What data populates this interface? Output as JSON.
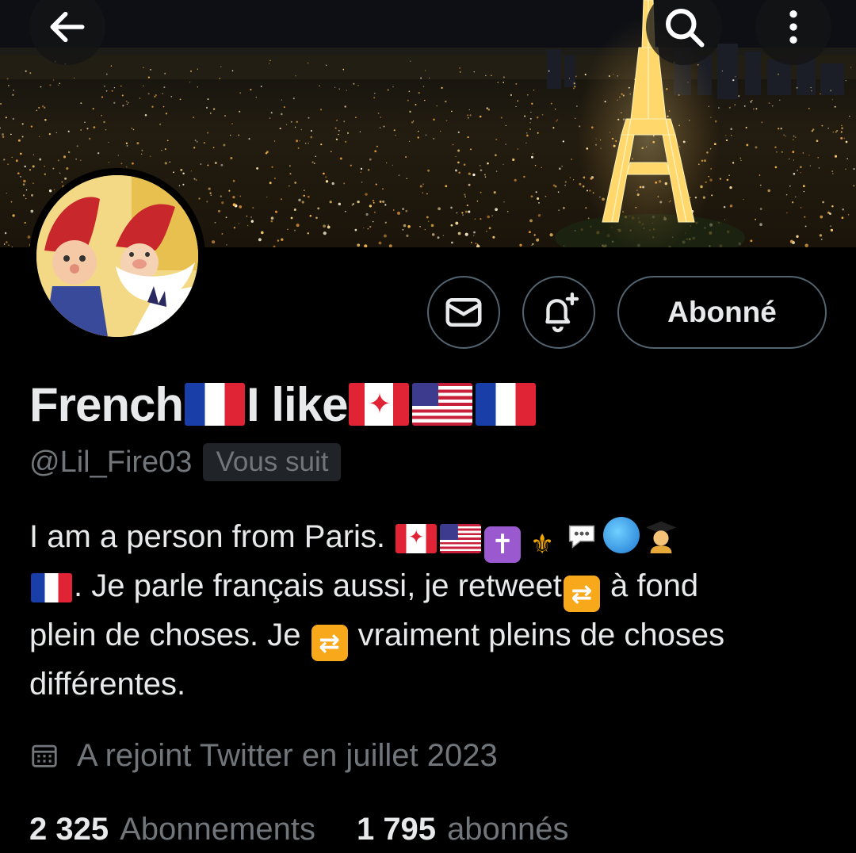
{
  "header": {
    "back_icon": "arrow-left-icon",
    "search_icon": "search-icon",
    "more_icon": "more-vertical-icon",
    "banner": "night-city-eiffel-tower-banner"
  },
  "profile": {
    "name_text_1": "French",
    "name_text_2": "I like",
    "handle": "@Lil_Fire03",
    "follows_you": "Vous suit",
    "avatar": "cartoon-gnome-avatar"
  },
  "actions": {
    "message_icon": "mail-icon",
    "notify_icon": "bell-plus-icon",
    "follow_label": "Abonné"
  },
  "bio": {
    "line1_text": "I am a person from Paris. ",
    "line2_text": ". Je parle français aussi, je retweet",
    "line2_rest": " à fond",
    "line3_text": "plein de choses. Je ",
    "line3_rest": " vraiment pleins de choses",
    "line4_text": "différentes."
  },
  "joined": {
    "icon": "calendar-icon",
    "text": "A rejoint Twitter en juillet 2023"
  },
  "stats": {
    "following_count": "2 325",
    "following_label": "Abonnements",
    "followers_count": "1 795",
    "followers_label": "abonnés"
  },
  "colors": {
    "background": "#000000",
    "text_primary": "#e7e9ea",
    "text_secondary": "#71767b",
    "border": "#536471",
    "badge_bg": "#202327"
  }
}
